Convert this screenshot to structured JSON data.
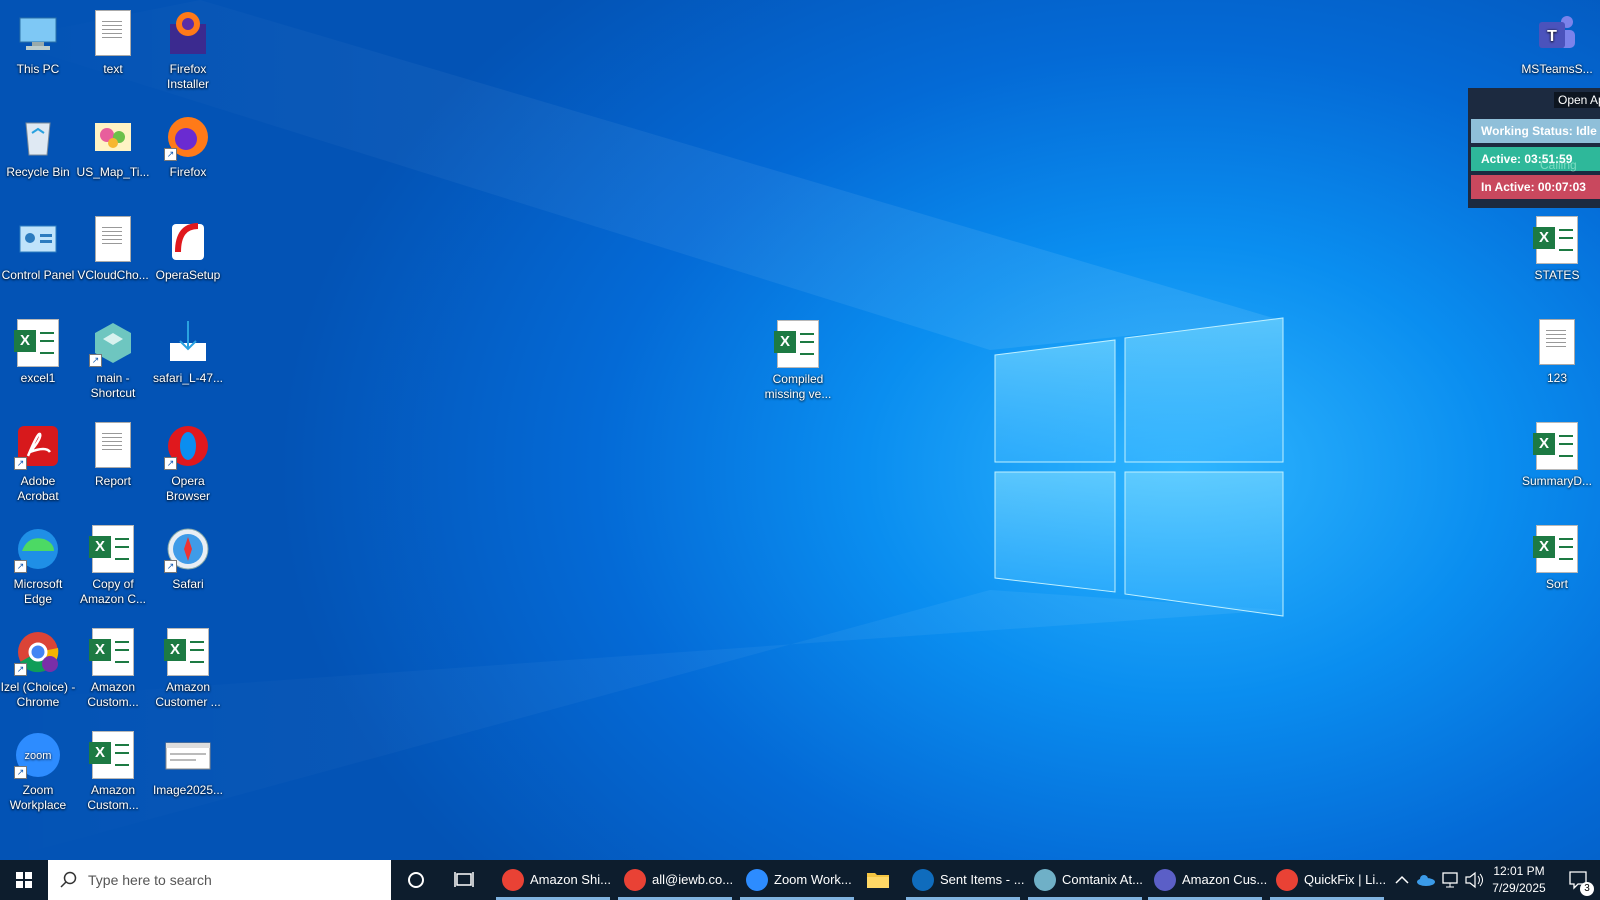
{
  "desktop": {
    "left_icons": [
      {
        "name": "this-pc",
        "label": "This PC",
        "kind": "pc"
      },
      {
        "name": "text",
        "label": "text",
        "kind": "doc"
      },
      {
        "name": "firefox-installer",
        "label": "Firefox Installer",
        "kind": "ffi"
      },
      {
        "name": "recycle-bin",
        "label": "Recycle Bin",
        "kind": "bin"
      },
      {
        "name": "us-map",
        "label": "US_Map_Ti...",
        "kind": "map"
      },
      {
        "name": "firefox",
        "label": "Firefox",
        "kind": "ff"
      },
      {
        "name": "control-panel",
        "label": "Control Panel",
        "kind": "cp"
      },
      {
        "name": "vcloud",
        "label": "VCloudCho...",
        "kind": "doc"
      },
      {
        "name": "opera-setup",
        "label": "OperaSetup",
        "kind": "opsetup"
      },
      {
        "name": "excel1",
        "label": "excel1",
        "kind": "xl"
      },
      {
        "name": "main-shortcut",
        "label": "main - Shortcut",
        "kind": "main"
      },
      {
        "name": "safari-l",
        "label": "safari_L-47...",
        "kind": "dl"
      },
      {
        "name": "adobe-acrobat",
        "label": "Adobe Acrobat",
        "kind": "pdf"
      },
      {
        "name": "report",
        "label": "Report",
        "kind": "doc"
      },
      {
        "name": "opera-browser",
        "label": "Opera Browser",
        "kind": "opera"
      },
      {
        "name": "microsoft-edge",
        "label": "Microsoft Edge",
        "kind": "edge"
      },
      {
        "name": "copy-of-amazon",
        "label": "Copy of Amazon C...",
        "kind": "xl"
      },
      {
        "name": "safari",
        "label": "Safari",
        "kind": "safari"
      },
      {
        "name": "izel-chrome",
        "label": "Izel (Choice) - Chrome",
        "kind": "chrome"
      },
      {
        "name": "amazon-custom-1",
        "label": "Amazon Custom...",
        "kind": "xl"
      },
      {
        "name": "amazon-customer",
        "label": "Amazon Customer ...",
        "kind": "xl"
      },
      {
        "name": "zoom-workplace",
        "label": "Zoom Workplace",
        "kind": "zoom"
      },
      {
        "name": "amazon-custom-2",
        "label": "Amazon Custom...",
        "kind": "xl"
      },
      {
        "name": "image2025",
        "label": "Image2025...",
        "kind": "img"
      }
    ],
    "center_icon": {
      "label": "Compiled missing ve..."
    },
    "right_icons": [
      {
        "name": "msteams",
        "label": "MSTeamsS...",
        "kind": "teams"
      },
      {
        "name": "states",
        "label": "STATES",
        "kind": "xl"
      },
      {
        "name": "file-123",
        "label": "123",
        "kind": "doc"
      },
      {
        "name": "summary",
        "label": "SummaryD...",
        "kind": "xl"
      },
      {
        "name": "sort",
        "label": "Sort",
        "kind": "xl"
      }
    ],
    "calling_label": "Calling"
  },
  "status_widget": {
    "open_app": "Open Ap",
    "working_status": "Working Status: Idle",
    "active": "Active: 03:51:59",
    "inactive": "In Active: 00:07:03"
  },
  "taskbar": {
    "search_placeholder": "Type here to search",
    "apps": [
      {
        "name": "amazon-shi",
        "label": "Amazon Shi...",
        "color": "#e94235"
      },
      {
        "name": "all-iewb",
        "label": "all@iewb.co...",
        "color": "#e94235"
      },
      {
        "name": "zoom-work",
        "label": "Zoom Work...",
        "color": "#2d8cff"
      },
      {
        "name": "sent-items",
        "label": "Sent Items - ...",
        "color": "#0f6cbd"
      },
      {
        "name": "comtanix",
        "label": "Comtanix At...",
        "color": "#6fb0c7"
      },
      {
        "name": "amazon-cus",
        "label": "Amazon Cus...",
        "color": "#5b5fc7"
      },
      {
        "name": "quickfix",
        "label": "QuickFix | Li...",
        "color": "#e94235"
      }
    ],
    "time": "12:01 PM",
    "date": "7/29/2025",
    "notification_count": "3"
  }
}
